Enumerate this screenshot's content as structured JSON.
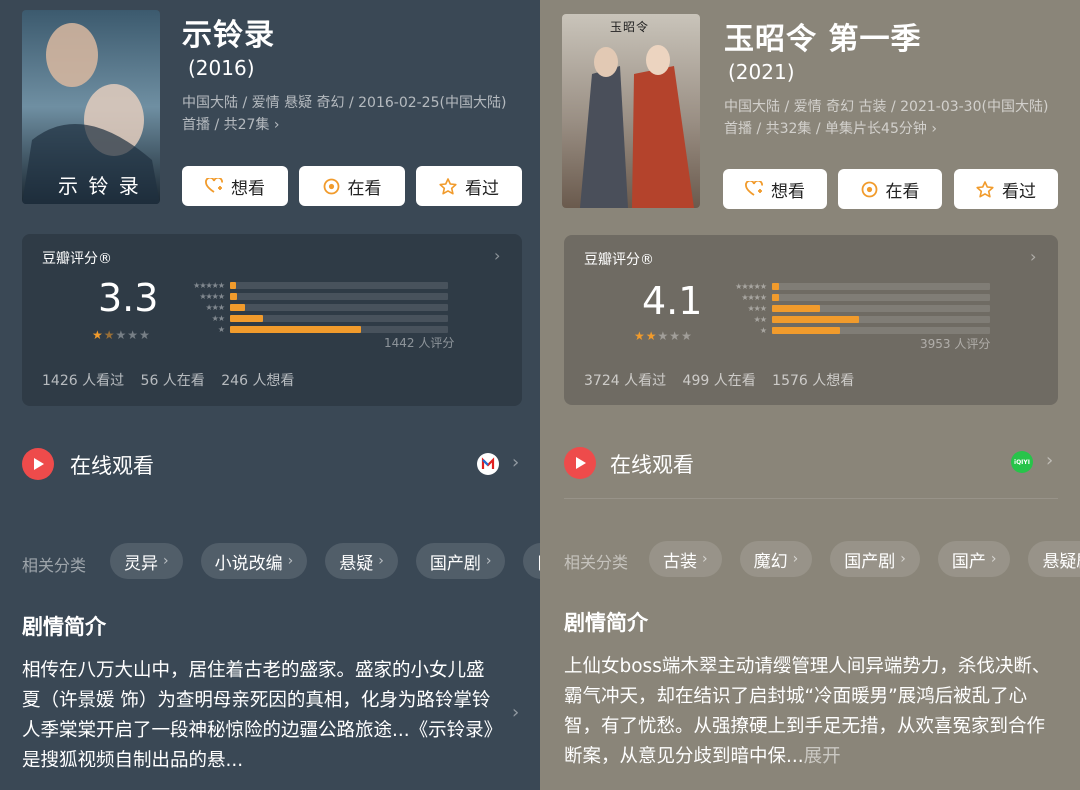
{
  "left": {
    "title": "示铃录",
    "year": "(2016)",
    "meta": "中国大陆 / 爱情 悬疑 奇幻 / 2016-02-25(中国大陆) 首播 / 共27集 ›",
    "poster_text": "示 铃 录",
    "buttons": {
      "want": "想看",
      "watching": "在看",
      "watched": "看过"
    },
    "rating": {
      "label": "豆瓣评分®",
      "score": "3.3",
      "stars": 1.5,
      "distribution": [
        2,
        3,
        7,
        15,
        60
      ],
      "star_labels": [
        "★★★★★",
        "★★★★",
        "★★★",
        "★★",
        "★"
      ],
      "count": "1442 人评分",
      "stats": [
        "1426 人看过",
        "56 人在看",
        "246 人想看"
      ]
    },
    "online": {
      "label": "在线观看",
      "platform": "sohu-icon"
    },
    "tags_label": "相关分类",
    "tags": [
      "灵异",
      "小说改编",
      "悬疑",
      "国产剧",
      "网"
    ],
    "synopsis_title": "剧情简介",
    "synopsis": "相传在八万大山中，居住着古老的盛家。盛家的小女儿盛夏（许景媛 饰）为查明母亲死因的真相，化身为路铃掌铃人季棠棠开启了一段神秘惊险的边疆公路旅途...《示铃录》是搜狐视频自制出品的悬..."
  },
  "right": {
    "title": "玉昭令 第一季",
    "year": "(2021)",
    "meta": "中国大陆 / 爱情 奇幻 古装 / 2021-03-30(中国大陆) 首播 / 共32集 / 单集片长45分钟 ›",
    "poster_text": "玉昭令",
    "buttons": {
      "want": "想看",
      "watching": "在看",
      "watched": "看过"
    },
    "rating": {
      "label": "豆瓣评分®",
      "score": "4.1",
      "stars": 2,
      "distribution": [
        3,
        3,
        22,
        40,
        31
      ],
      "star_labels": [
        "★★★★★",
        "★★★★",
        "★★★",
        "★★",
        "★"
      ],
      "count": "3953 人评分",
      "stats": [
        "3724 人看过",
        "499 人在看",
        "1576 人想看"
      ]
    },
    "online": {
      "label": "在线观看",
      "platform": "iqiyi-icon",
      "platform_text": "iQIYI"
    },
    "tags_label": "相关分类",
    "tags": [
      "古装",
      "魔幻",
      "国产剧",
      "国产",
      "悬疑剧"
    ],
    "synopsis_title": "剧情简介",
    "synopsis": "上仙女boss端木翠主动请缨管理人间异端势力，杀伐决断、霸气冲天，却在结识了启封城“冷面暖男”展鸿后被乱了心智，有了忧愁。从强撩硬上到手足无措，从欢喜冤家到合作断案，从意见分歧到暗中保...",
    "expand": "展开"
  },
  "colors": {
    "accent": "#f19b2c",
    "play": "#ee4b4b",
    "left_bg": "#3a4855",
    "right_bg": "#8a8579"
  }
}
